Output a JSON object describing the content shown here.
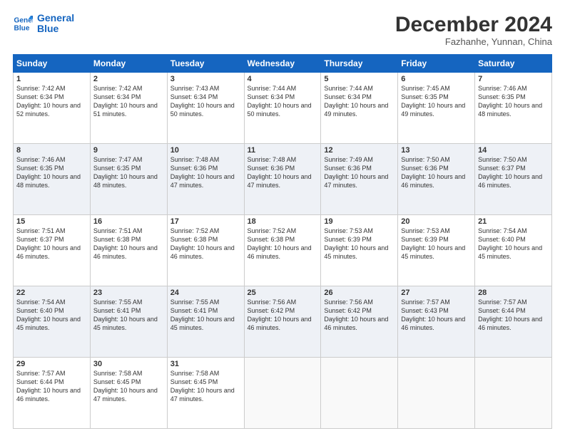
{
  "logo": {
    "line1": "General",
    "line2": "Blue"
  },
  "title": "December 2024",
  "subtitle": "Fazhanhe, Yunnan, China",
  "days_header": [
    "Sunday",
    "Monday",
    "Tuesday",
    "Wednesday",
    "Thursday",
    "Friday",
    "Saturday"
  ],
  "weeks": [
    [
      {
        "day": "1",
        "sunrise": "7:42 AM",
        "sunset": "6:34 PM",
        "daylight": "10 hours and 52 minutes."
      },
      {
        "day": "2",
        "sunrise": "7:42 AM",
        "sunset": "6:34 PM",
        "daylight": "10 hours and 51 minutes."
      },
      {
        "day": "3",
        "sunrise": "7:43 AM",
        "sunset": "6:34 PM",
        "daylight": "10 hours and 50 minutes."
      },
      {
        "day": "4",
        "sunrise": "7:44 AM",
        "sunset": "6:34 PM",
        "daylight": "10 hours and 50 minutes."
      },
      {
        "day": "5",
        "sunrise": "7:44 AM",
        "sunset": "6:34 PM",
        "daylight": "10 hours and 49 minutes."
      },
      {
        "day": "6",
        "sunrise": "7:45 AM",
        "sunset": "6:35 PM",
        "daylight": "10 hours and 49 minutes."
      },
      {
        "day": "7",
        "sunrise": "7:46 AM",
        "sunset": "6:35 PM",
        "daylight": "10 hours and 48 minutes."
      }
    ],
    [
      {
        "day": "8",
        "sunrise": "7:46 AM",
        "sunset": "6:35 PM",
        "daylight": "10 hours and 48 minutes."
      },
      {
        "day": "9",
        "sunrise": "7:47 AM",
        "sunset": "6:35 PM",
        "daylight": "10 hours and 48 minutes."
      },
      {
        "day": "10",
        "sunrise": "7:48 AM",
        "sunset": "6:36 PM",
        "daylight": "10 hours and 47 minutes."
      },
      {
        "day": "11",
        "sunrise": "7:48 AM",
        "sunset": "6:36 PM",
        "daylight": "10 hours and 47 minutes."
      },
      {
        "day": "12",
        "sunrise": "7:49 AM",
        "sunset": "6:36 PM",
        "daylight": "10 hours and 47 minutes."
      },
      {
        "day": "13",
        "sunrise": "7:50 AM",
        "sunset": "6:36 PM",
        "daylight": "10 hours and 46 minutes."
      },
      {
        "day": "14",
        "sunrise": "7:50 AM",
        "sunset": "6:37 PM",
        "daylight": "10 hours and 46 minutes."
      }
    ],
    [
      {
        "day": "15",
        "sunrise": "7:51 AM",
        "sunset": "6:37 PM",
        "daylight": "10 hours and 46 minutes."
      },
      {
        "day": "16",
        "sunrise": "7:51 AM",
        "sunset": "6:38 PM",
        "daylight": "10 hours and 46 minutes."
      },
      {
        "day": "17",
        "sunrise": "7:52 AM",
        "sunset": "6:38 PM",
        "daylight": "10 hours and 46 minutes."
      },
      {
        "day": "18",
        "sunrise": "7:52 AM",
        "sunset": "6:38 PM",
        "daylight": "10 hours and 46 minutes."
      },
      {
        "day": "19",
        "sunrise": "7:53 AM",
        "sunset": "6:39 PM",
        "daylight": "10 hours and 45 minutes."
      },
      {
        "day": "20",
        "sunrise": "7:53 AM",
        "sunset": "6:39 PM",
        "daylight": "10 hours and 45 minutes."
      },
      {
        "day": "21",
        "sunrise": "7:54 AM",
        "sunset": "6:40 PM",
        "daylight": "10 hours and 45 minutes."
      }
    ],
    [
      {
        "day": "22",
        "sunrise": "7:54 AM",
        "sunset": "6:40 PM",
        "daylight": "10 hours and 45 minutes."
      },
      {
        "day": "23",
        "sunrise": "7:55 AM",
        "sunset": "6:41 PM",
        "daylight": "10 hours and 45 minutes."
      },
      {
        "day": "24",
        "sunrise": "7:55 AM",
        "sunset": "6:41 PM",
        "daylight": "10 hours and 45 minutes."
      },
      {
        "day": "25",
        "sunrise": "7:56 AM",
        "sunset": "6:42 PM",
        "daylight": "10 hours and 46 minutes."
      },
      {
        "day": "26",
        "sunrise": "7:56 AM",
        "sunset": "6:42 PM",
        "daylight": "10 hours and 46 minutes."
      },
      {
        "day": "27",
        "sunrise": "7:57 AM",
        "sunset": "6:43 PM",
        "daylight": "10 hours and 46 minutes."
      },
      {
        "day": "28",
        "sunrise": "7:57 AM",
        "sunset": "6:44 PM",
        "daylight": "10 hours and 46 minutes."
      }
    ],
    [
      {
        "day": "29",
        "sunrise": "7:57 AM",
        "sunset": "6:44 PM",
        "daylight": "10 hours and 46 minutes."
      },
      {
        "day": "30",
        "sunrise": "7:58 AM",
        "sunset": "6:45 PM",
        "daylight": "10 hours and 47 minutes."
      },
      {
        "day": "31",
        "sunrise": "7:58 AM",
        "sunset": "6:45 PM",
        "daylight": "10 hours and 47 minutes."
      },
      null,
      null,
      null,
      null
    ]
  ]
}
